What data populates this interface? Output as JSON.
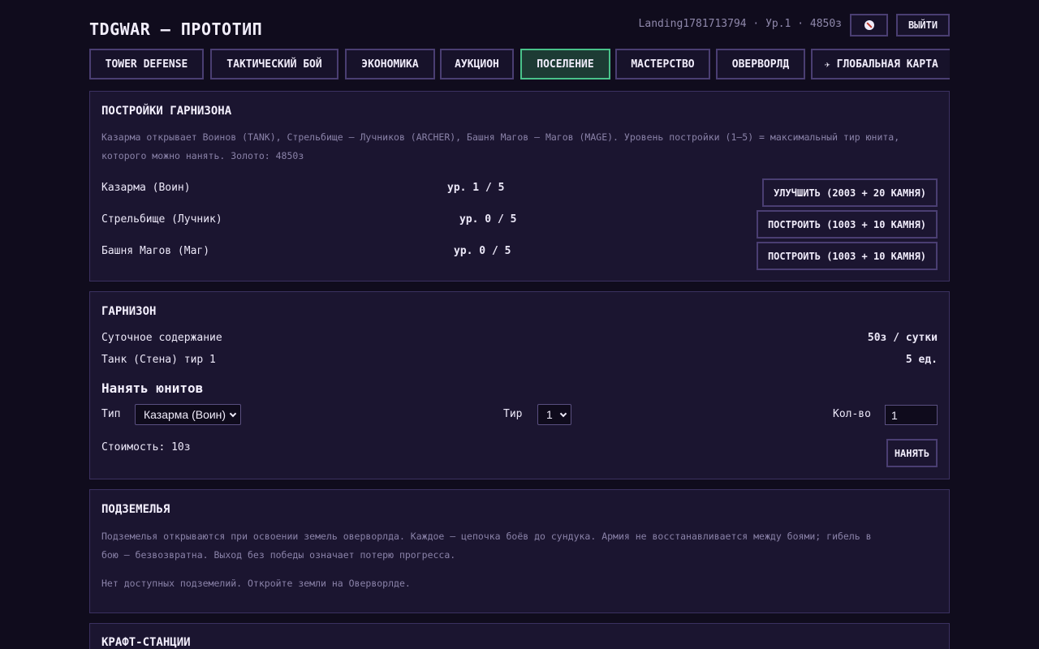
{
  "header": {
    "app_title": "TDGWAR — ПРОТОТИП",
    "user_info": "Landing1781713794 · Ур.1 · 4850з",
    "mute_icon": "mute-speaker-icon",
    "logout_label": "ВЫЙТИ"
  },
  "tabs": [
    {
      "label": "TOWER DEFENSE",
      "active": false
    },
    {
      "label": "ТАКТИЧЕСКИЙ БОЙ",
      "active": false
    },
    {
      "label": "ЭКОНОМИКА",
      "active": false
    },
    {
      "label": "АУКЦИОН",
      "active": false
    },
    {
      "label": "ПОСЕЛЕНИЕ",
      "active": true
    },
    {
      "label": "МАСТЕРСТВО",
      "active": false
    },
    {
      "label": "ОВЕРВОРЛД",
      "active": false
    },
    {
      "label": "ГЛОБАЛЬНАЯ КАРТА",
      "active": false,
      "icon": "world-map-icon"
    }
  ],
  "buildings": {
    "title": "ПОСТРОЙКИ ГАРНИЗОНА",
    "description": "Казарма открывает Воинов (TANK), Стрельбище — Лучников (ARCHER), Башня Магов — Магов (MAGE). Уровень постройки (1–5) = максимальный тир юнита, которого можно нанять. Золото: 4850з",
    "rows": [
      {
        "name": "Казарма (Воин)",
        "level": "ур. 1 / 5",
        "action": "УЛУЧШИТЬ (200З + 20 КАМНЯ)"
      },
      {
        "name": "Стрельбище (Лучник)",
        "level": "ур. 0 / 5",
        "action": "ПОСТРОИТЬ (100З + 10 КАМНЯ)"
      },
      {
        "name": "Башня Магов (Маг)",
        "level": "ур. 0 / 5",
        "action": "ПОСТРОИТЬ (100З + 10 КАМНЯ)"
      }
    ]
  },
  "garrison": {
    "title": "ГАРНИЗОН",
    "upkeep_label": "Суточное содержание",
    "upkeep_value": "50з / сутки",
    "unit_label": "Танк (Стена) тир 1",
    "unit_value": "5 ед.",
    "hire_title": "Нанять юнитов",
    "type_label": "Тип",
    "type_value": "Казарма (Воин)",
    "tier_label": "Тир",
    "tier_value": "1",
    "qty_label": "Кол-во",
    "qty_value": "1",
    "cost_text": "Стоимость: 10з",
    "hire_button": "НАНЯТЬ"
  },
  "dungeons": {
    "title": "ПОДЗЕМЕЛЬЯ",
    "description": "Подземелья открываются при освоении земель оверворлда. Каждое — цепочка боёв до сундука. Армия не восстанавливается между боями; гибель в бою — безвозвратна. Выход без победы означает потерю прогресса.",
    "empty_text": "Нет доступных подземелий. Откройте земли на Оверворлде."
  },
  "craft": {
    "title": "КРАФТ-СТАНЦИИ"
  }
}
